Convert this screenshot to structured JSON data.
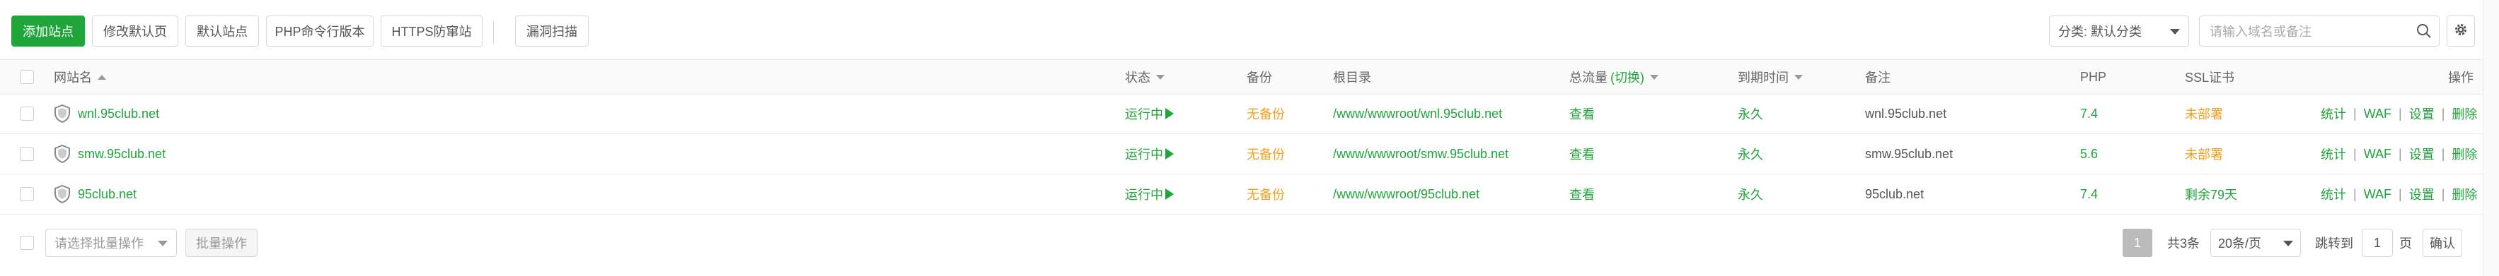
{
  "toolbar": {
    "add_site": "添加站点",
    "modify_default_page": "修改默认页",
    "default_site": "默认站点",
    "php_cli_version": "PHP命令行版本",
    "https_protect": "HTTPS防窜站",
    "vuln_scan": "漏洞扫描",
    "category_label": "分类: 默认分类",
    "search_placeholder": "请输入域名或备注"
  },
  "table": {
    "headers": {
      "name": "网站名",
      "status": "状态",
      "backup": "备份",
      "root": "根目录",
      "traffic": "总流量",
      "traffic_switch": "(切换)",
      "expire": "到期时间",
      "remark": "备注",
      "php": "PHP",
      "ssl": "SSL证书",
      "actions": "操作"
    },
    "rows": [
      {
        "name": "wnl.95club.net",
        "status": "运行中",
        "backup": "无备份",
        "root": "/www/wwwroot/wnl.95club.net",
        "traffic": "查看",
        "expire": "永久",
        "remark": "wnl.95club.net",
        "php": "7.4",
        "ssl": "未部署",
        "ops": [
          "统计",
          "WAF",
          "设置",
          "删除"
        ]
      },
      {
        "name": "smw.95club.net",
        "status": "运行中",
        "backup": "无备份",
        "root": "/www/wwwroot/smw.95club.net",
        "traffic": "查看",
        "expire": "永久",
        "remark": "smw.95club.net",
        "php": "5.6",
        "ssl": "未部署",
        "ops": [
          "统计",
          "WAF",
          "设置",
          "删除"
        ]
      },
      {
        "name": "95club.net",
        "status": "运行中",
        "backup": "无备份",
        "root": "/www/wwwroot/95club.net",
        "traffic": "查看",
        "expire": "永久",
        "remark": "95club.net",
        "php": "7.4",
        "ssl": "剩余79天",
        "ops": [
          "统计",
          "WAF",
          "设置",
          "删除"
        ]
      }
    ]
  },
  "footer": {
    "batch_placeholder": "请选择批量操作",
    "batch_button": "批量操作",
    "current_page": "1",
    "total": "共3条",
    "page_size": "20条/页",
    "goto_label": "跳转到",
    "goto_value": "1",
    "page_unit": "页",
    "confirm": "确认"
  },
  "colors": {
    "accent": "#20a53a",
    "warning": "#f0a020"
  },
  "icons": {
    "site_icon": "shield-icon",
    "search": "search-icon",
    "settings": "gear-icon"
  }
}
